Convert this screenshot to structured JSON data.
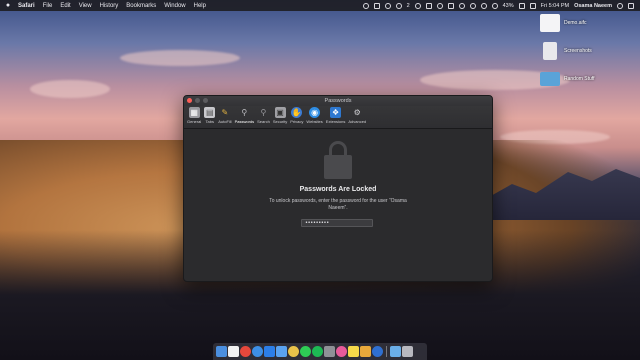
{
  "menubar": {
    "app_name": "Safari",
    "menus": [
      "File",
      "Edit",
      "View",
      "History",
      "Bookmarks",
      "Window",
      "Help"
    ],
    "notification_count": "2",
    "battery": "43%",
    "clock": "Fri 5:04 PM",
    "user": "Osama Naeem"
  },
  "desktop": {
    "items": [
      {
        "label": "Demo.aifc",
        "icon": "audio-file-icon",
        "color": "#ffffff"
      },
      {
        "label": "Screenshots",
        "icon": "folder-icon",
        "color": "#ffffff"
      },
      {
        "label": "Random Stuff",
        "icon": "folder-icon",
        "color": "#5aa3d8"
      }
    ]
  },
  "window": {
    "title": "Passwords",
    "toolbar": [
      {
        "label": "General",
        "icon": "general-icon",
        "color": "#9a9a9f"
      },
      {
        "label": "Tabs",
        "icon": "tabs-icon",
        "color": "#c8c8cc"
      },
      {
        "label": "AutoFill",
        "icon": "autofill-icon",
        "color": "#e0b040"
      },
      {
        "label": "Passwords",
        "icon": "key-icon",
        "color": "#bdbdc2"
      },
      {
        "label": "Search",
        "icon": "search-icon",
        "color": "#8a8a8f"
      },
      {
        "label": "Security",
        "icon": "lock-icon",
        "color": "#a0a0a5"
      },
      {
        "label": "Privacy",
        "icon": "privacy-hand-icon",
        "color": "#3a7bd5"
      },
      {
        "label": "Websites",
        "icon": "globe-icon",
        "color": "#2f8de4"
      },
      {
        "label": "Extensions",
        "icon": "puzzle-icon",
        "color": "#2e78d0"
      },
      {
        "label": "Advanced",
        "icon": "gear-icon",
        "color": "#8a8a90"
      }
    ],
    "selected_tab": "Passwords",
    "locked_title": "Passwords Are Locked",
    "locked_message": "To unlock passwords, enter the password for the user “Osama Naeem”.",
    "password_value": "•••••••••"
  },
  "dock": {
    "apps": [
      {
        "icon": "finder-icon",
        "color": "#4b8fe0"
      },
      {
        "icon": "calendar-icon",
        "color": "#f2f2f2"
      },
      {
        "icon": "chrome-icon",
        "color": "#e5483c"
      },
      {
        "icon": "safari-icon",
        "color": "#3d8fe6"
      },
      {
        "icon": "app-store-icon",
        "color": "#2c7ee8"
      },
      {
        "icon": "mail-icon",
        "color": "#5aa2f0"
      },
      {
        "icon": "photos-icon",
        "color": "#e9c24a"
      },
      {
        "icon": "whatsapp-icon",
        "color": "#2ecc55"
      },
      {
        "icon": "spotify-icon",
        "color": "#1db954"
      },
      {
        "icon": "system-preferences-icon",
        "color": "#8f9197"
      },
      {
        "icon": "itunes-icon",
        "color": "#e85a9a"
      },
      {
        "icon": "notes-icon",
        "color": "#f6d94a"
      },
      {
        "icon": "sketch-icon",
        "color": "#e9a93b"
      },
      {
        "icon": "quicktime-icon",
        "color": "#2f6fd0"
      },
      {
        "icon": "downloads-folder-icon",
        "color": "#6aaee8"
      },
      {
        "icon": "trash-icon",
        "color": "#b8b8bf"
      }
    ]
  }
}
